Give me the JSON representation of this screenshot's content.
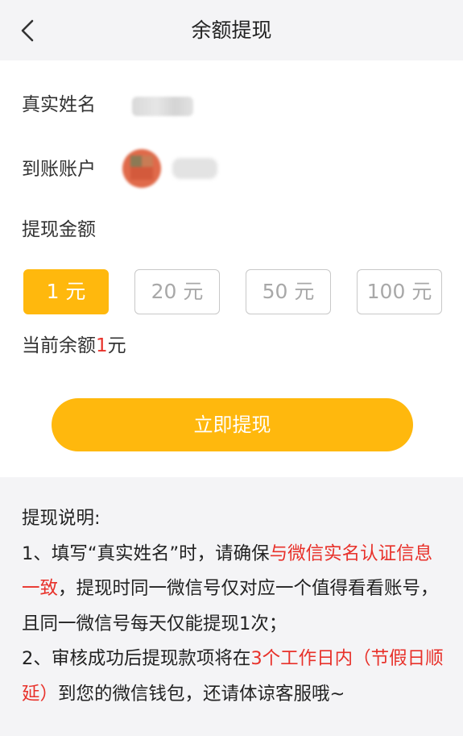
{
  "header": {
    "title": "余额提现"
  },
  "form": {
    "name_label": "真实姓名",
    "account_label": "到账账户",
    "amount_label": "提现金额"
  },
  "amounts": [
    {
      "label": "1 元",
      "selected": true
    },
    {
      "label": "20 元",
      "selected": false
    },
    {
      "label": "50 元",
      "selected": false
    },
    {
      "label": "100 元",
      "selected": false
    }
  ],
  "balance": {
    "prefix": "当前余额",
    "value": "1",
    "unit": "元"
  },
  "withdraw_button": "立即提现",
  "notes": {
    "title": "提现说明:",
    "line1_pre": "1、填写“真实姓名”时，请确保",
    "line1_red": "与微信实名认证信息一致",
    "line1_post": "，提现时同一微信号仅对应一个值得看看账号，且同一微信号每天仅能提现1次；",
    "line2_pre": "2、审核成功后提现款项将在",
    "line2_red": "3个工作日内（节假日顺延）",
    "line2_post": "到您的微信钱包，还请体谅客服哦~"
  },
  "colors": {
    "accent": "#ffb80d",
    "highlight": "#e8312a",
    "background": "#f4f4f6"
  },
  "icons": {
    "back": "chevron-left-icon"
  }
}
